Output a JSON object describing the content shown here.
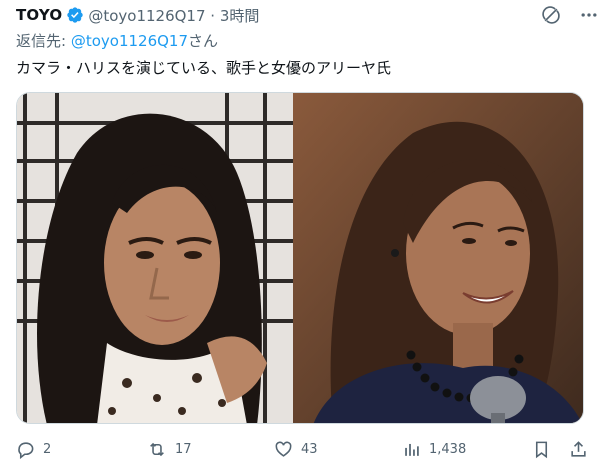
{
  "author": {
    "name": "TOYO",
    "handle_time": "@toyo1126Q17 · 3時間"
  },
  "replying": {
    "prefix": "返信先: ",
    "mention": "@toyo1126Q17",
    "suffix": "さん"
  },
  "tweet": {
    "text": "カマラ・ハリスを演じている、歌手と女優のアリーヤ氏"
  },
  "actions": {
    "replies": "2",
    "retweets": "17",
    "likes": "43",
    "views": "1,438"
  },
  "icons": {
    "verified": "verified-badge-icon",
    "grok": "grok-icon",
    "more": "more-icon",
    "reply": "reply-icon",
    "retweet": "retweet-icon",
    "like": "heart-icon",
    "views": "views-icon",
    "bookmark": "bookmark-icon",
    "share": "share-icon"
  },
  "colors": {
    "text": "#0f1419",
    "secondary": "#536471",
    "accent": "#1d9bf0"
  }
}
